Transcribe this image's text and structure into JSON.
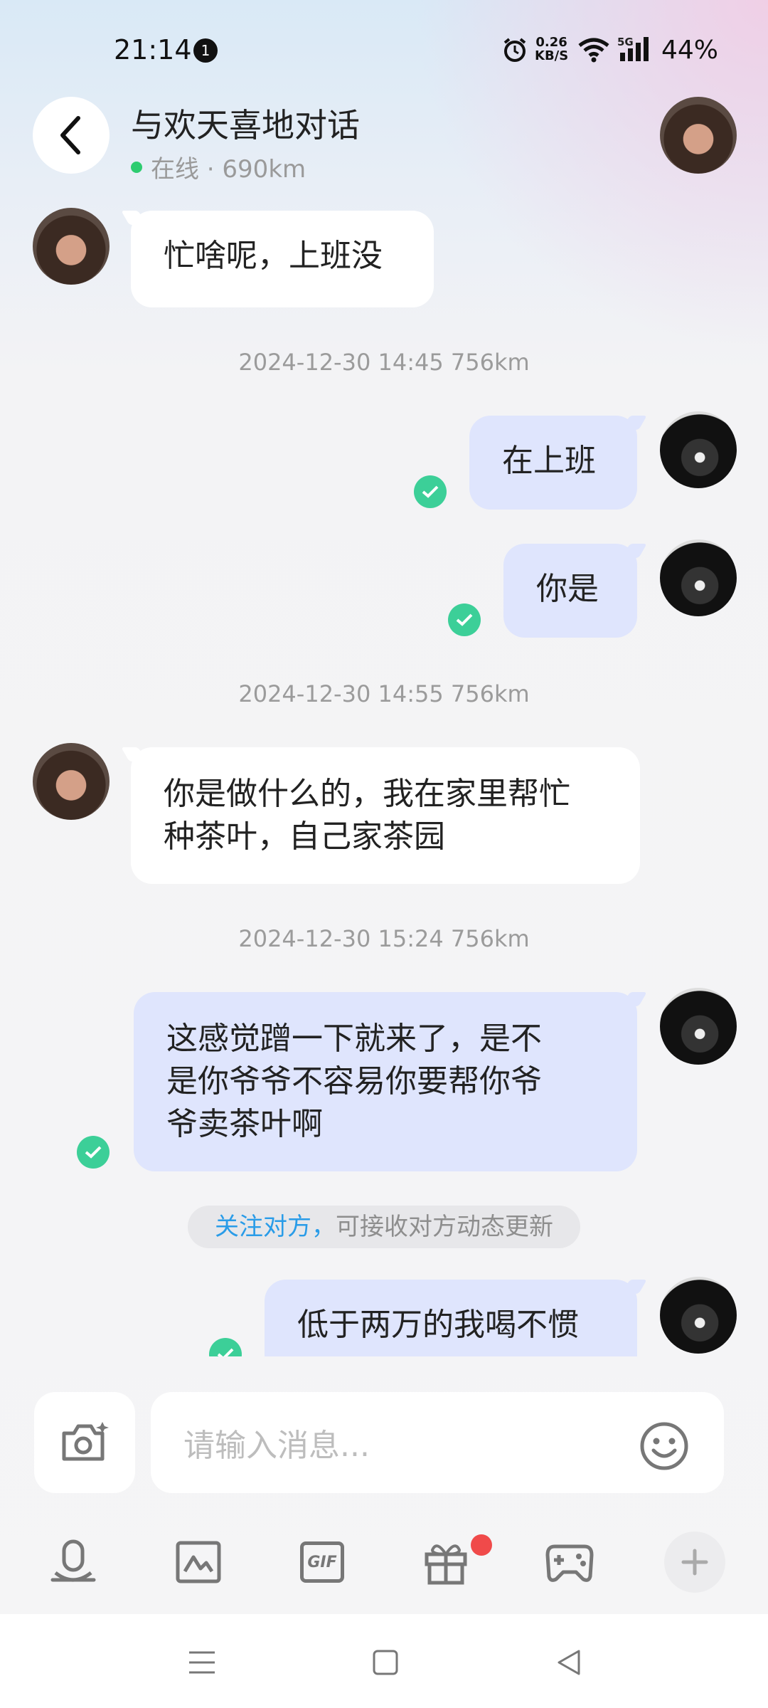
{
  "status_bar": {
    "time": "21:14",
    "notification_count": "1",
    "net_speed_value": "0.26",
    "net_speed_unit": "KB/S",
    "network_type": "5G",
    "battery": "44%"
  },
  "header": {
    "title": "与欢天喜地对话",
    "status": "在线 · 690km"
  },
  "messages": [
    {
      "sender": "her",
      "text": "忙啥呢，上班没"
    },
    {
      "timestamp": "2024-12-30 14:45  756km"
    },
    {
      "sender": "me",
      "text": "在上班",
      "read": true
    },
    {
      "sender": "me",
      "text": "你是",
      "read": true
    },
    {
      "timestamp": "2024-12-30 14:55  756km"
    },
    {
      "sender": "her",
      "text_line1": "你是做什么的，我在家里帮忙",
      "text_line2": "种茶叶，自己家茶园"
    },
    {
      "timestamp": "2024-12-30 15:24  756km"
    },
    {
      "sender": "me",
      "text_line1": "这感觉蹭一下就来了，是不",
      "text_line2": "是你爷爷不容易你要帮你爷",
      "text_line3": "爷卖茶叶啊",
      "read": true
    },
    {
      "sender": "me",
      "text": "低于两万的我喝不惯",
      "read": true
    }
  ],
  "follow_tip": {
    "highlight": "关注对方，",
    "rest": "可接收对方动态更新"
  },
  "input": {
    "placeholder": "请输入消息..."
  },
  "toolbar": {
    "icons": [
      "voice-icon",
      "image-icon",
      "gif-icon",
      "gift-icon",
      "game-icon",
      "plus-icon"
    ],
    "gif_label": "GIF",
    "accent": "#f04a4a"
  },
  "colors": {
    "my_bubble": "#dfe5fd",
    "her_bubble": "#ffffff",
    "read_check": "#3ccf98",
    "online_dot": "#2dcc70",
    "follow_link": "#2a9ce8"
  }
}
